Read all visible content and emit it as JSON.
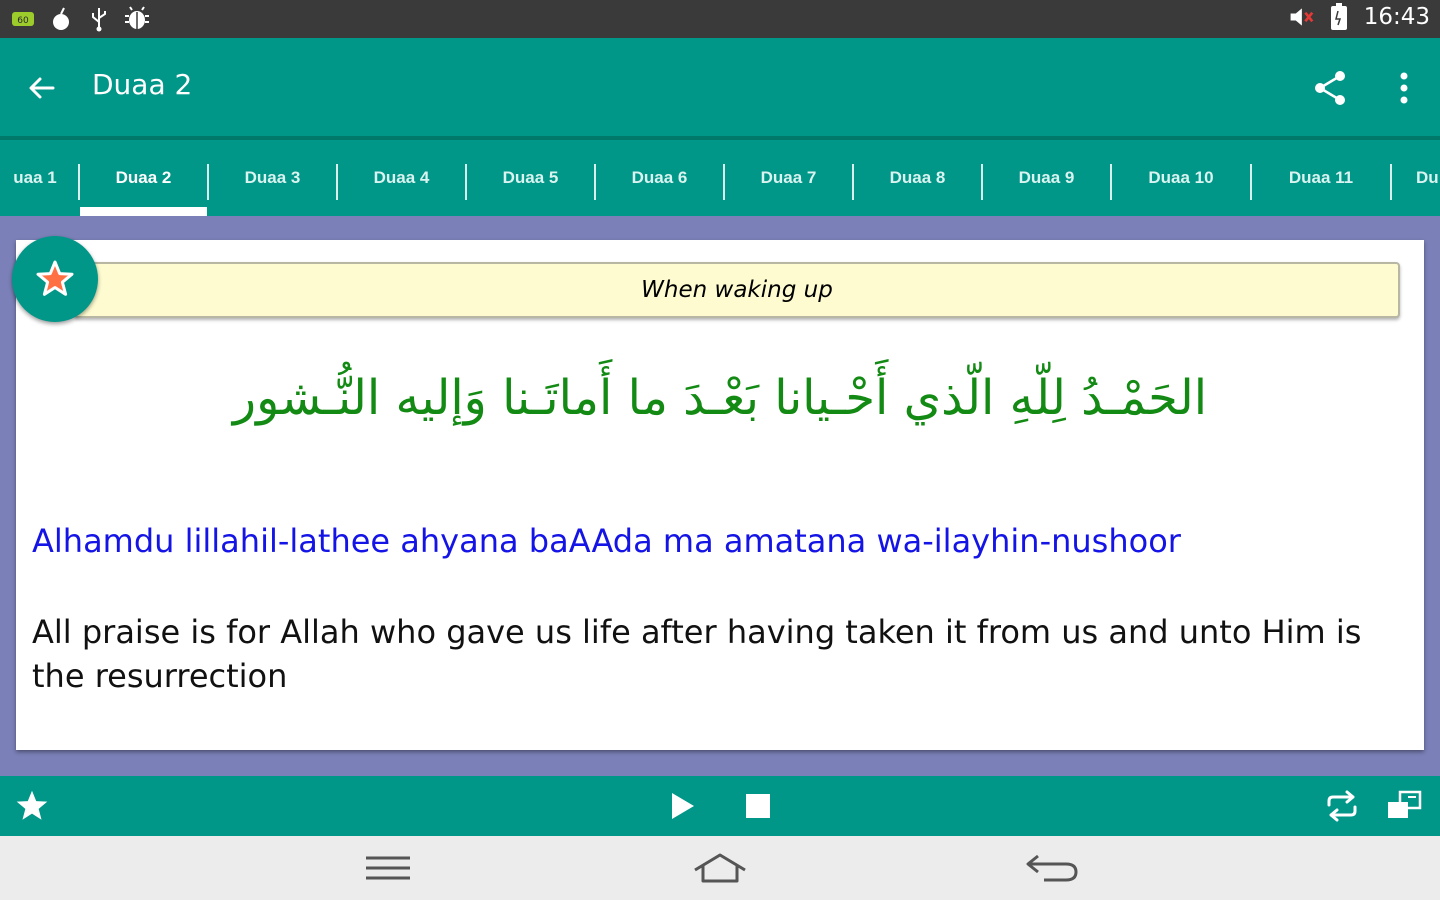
{
  "status_bar": {
    "time": "16:43",
    "left_icons": [
      "sd-card-icon",
      "gesture-icon",
      "usb-icon",
      "android-debug-icon"
    ],
    "right_icons": [
      "volume-muted-icon",
      "battery-icon"
    ]
  },
  "app_bar": {
    "title": "Duaa 2"
  },
  "tabs": [
    {
      "label": "uaa 1",
      "active": false
    },
    {
      "label": "Duaa 2",
      "active": true
    },
    {
      "label": "Duaa 3",
      "active": false
    },
    {
      "label": "Duaa 4",
      "active": false
    },
    {
      "label": "Duaa 5",
      "active": false
    },
    {
      "label": "Duaa 6",
      "active": false
    },
    {
      "label": "Duaa 7",
      "active": false
    },
    {
      "label": "Duaa 8",
      "active": false
    },
    {
      "label": "Duaa 9",
      "active": false
    },
    {
      "label": "Duaa 10",
      "active": false
    },
    {
      "label": "Duaa 11",
      "active": false
    },
    {
      "label": "Du",
      "active": false
    }
  ],
  "card": {
    "heading": "When waking up",
    "arabic": "الحَمْـدُ لِلّهِ الّذي أَحْـيانا بَعْـدَ ما أَماتَـنا وَإليه النُّـشور",
    "transliteration": "Alhamdu lillahil-lathee ahyana baAAda ma amatana wa-ilayhin-nushoor",
    "translation": "All praise is for Allah who gave us life after having taken it from us and unto Him is the resurrection"
  },
  "colors": {
    "primary": "#009688",
    "background": "#7b80b8",
    "arabic_text": "#138a13",
    "transliteration_text": "#1414e6",
    "heading_bg": "#fdfbcf"
  }
}
